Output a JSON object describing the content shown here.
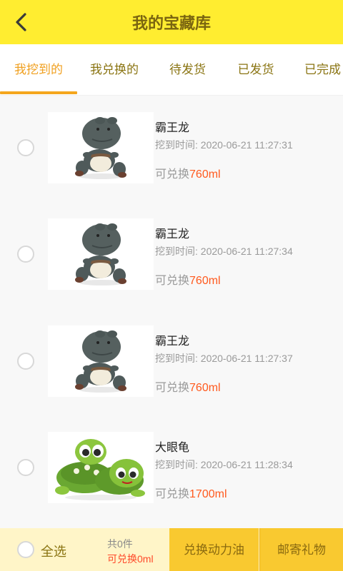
{
  "header": {
    "title": "我的宝藏库",
    "back_icon": "chevron-left-icon"
  },
  "tabs": [
    {
      "label": "我挖到的",
      "active": true
    },
    {
      "label": "我兑换的",
      "active": false
    },
    {
      "label": "待发货",
      "active": false
    },
    {
      "label": "已发货",
      "active": false
    },
    {
      "label": "已完成",
      "active": false
    }
  ],
  "colors": {
    "header_bg": "#ffed30",
    "accent": "#f4a61d",
    "price": "#ff5a1e",
    "footer_btn": "#f9c930"
  },
  "items": [
    {
      "name": "霸王龙",
      "time": "挖到时间: 2020-06-21 11:27:31",
      "exchange_label": "可兑换",
      "amount": "760ml",
      "image": "trex-plush"
    },
    {
      "name": "霸王龙",
      "time": "挖到时间: 2020-06-21 11:27:34",
      "exchange_label": "可兑换",
      "amount": "760ml",
      "image": "trex-plush"
    },
    {
      "name": "霸王龙",
      "time": "挖到时间: 2020-06-21 11:27:37",
      "exchange_label": "可兑换",
      "amount": "760ml",
      "image": "trex-plush"
    },
    {
      "name": "大眼龟",
      "time": "挖到时间: 2020-06-21 11:28:34",
      "exchange_label": "可兑换",
      "amount": "1700ml",
      "image": "turtle-plush"
    }
  ],
  "footer": {
    "select_all": "全选",
    "count": "共0件",
    "total": "可兑换0ml",
    "exchange_button": "兑换动力油",
    "mail_button": "邮寄礼物"
  }
}
